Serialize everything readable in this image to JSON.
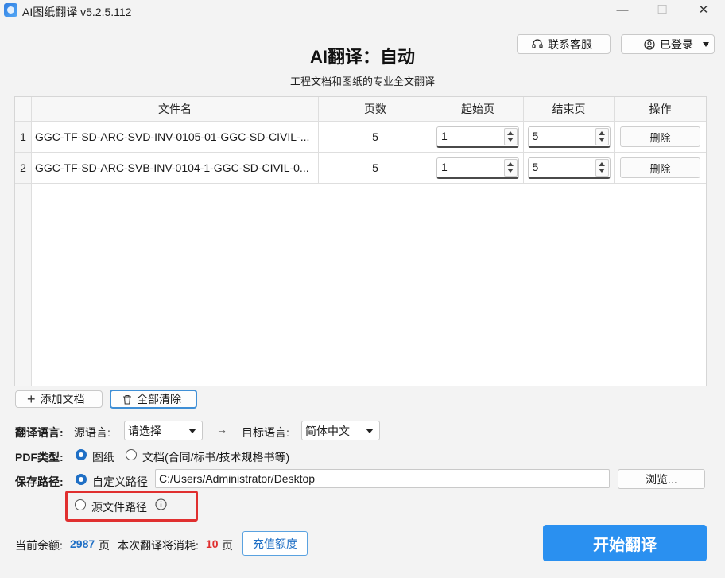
{
  "window": {
    "title": "AI图纸翻译 v5.2.5.112",
    "minimize": "—",
    "maximize": "☐",
    "close": "✕"
  },
  "header": {
    "support_label": "联系客服",
    "login_label": "已登录",
    "main_title": "AI翻译：自动",
    "subtitle": "工程文档和图纸的专业全文翻译"
  },
  "table": {
    "columns": [
      "文件名",
      "页数",
      "起始页",
      "结束页",
      "操作"
    ],
    "rows": [
      {
        "num": "1",
        "file": "GGC-TF-SD-ARC-SVD-INV-0105-01-GGC-SD-CIVIL-...",
        "pages": "5",
        "start": "1",
        "end": "5",
        "action": "删除"
      },
      {
        "num": "2",
        "file": "GGC-TF-SD-ARC-SVB-INV-0104-1-GGC-SD-CIVIL-0...",
        "pages": "5",
        "start": "1",
        "end": "5",
        "action": "删除"
      }
    ]
  },
  "actions": {
    "add_doc": "添加文档",
    "clear_all": "全部清除"
  },
  "language": {
    "label": "翻译语言:",
    "source_label": "源语言:",
    "source_value": "请选择",
    "arrow": "→",
    "target_label": "目标语言:",
    "target_value": "简体中文"
  },
  "pdf_type": {
    "label": "PDF类型:",
    "option_drawing": "图纸",
    "option_document": "文档(合同/标书/技术规格书等)",
    "selected": "图纸"
  },
  "save_path": {
    "label": "保存路径:",
    "option_custom": "自定义路径",
    "path_value": "C:/Users/Administrator/Desktop",
    "browse": "浏览...",
    "option_source": "源文件路径",
    "selected": "自定义路径"
  },
  "footer": {
    "balance_label": "当前余额:",
    "balance_value": "2987",
    "unit": "页",
    "cost_label": "本次翻译将消耗:",
    "cost_value": "10",
    "recharge": "充值额度",
    "start": "开始翻译"
  },
  "colors": {
    "accent": "#2a90f0",
    "radio_selected": "#1f6fc5",
    "balance": "#1f6fc5",
    "cost": "#e02f2f",
    "highlight": "#e02f2f"
  }
}
